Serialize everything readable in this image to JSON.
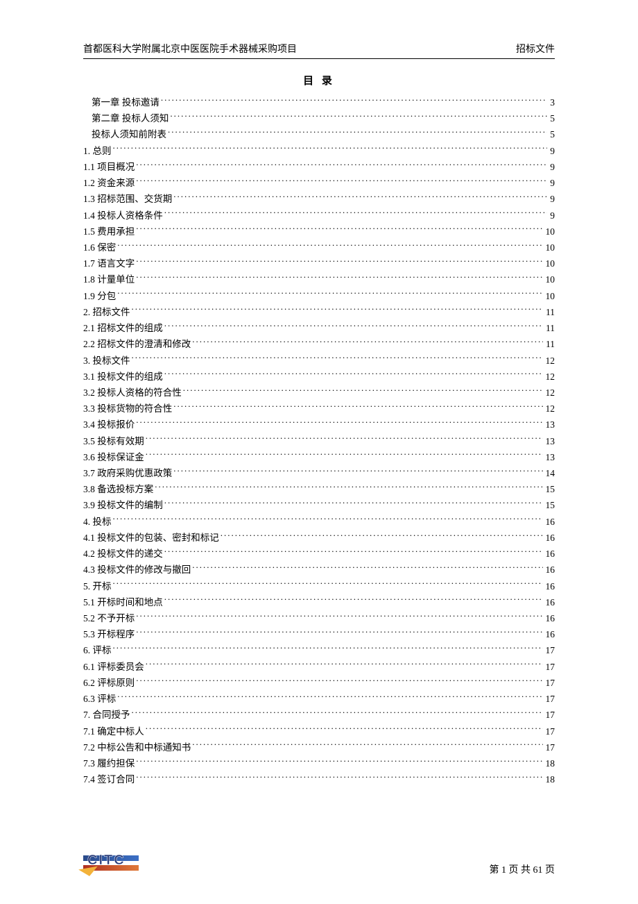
{
  "header": {
    "left": "首都医科大学附属北京中医医院手术器械采购项目",
    "right": "招标文件"
  },
  "toc_title": "目 录",
  "toc": [
    {
      "label": "第一章 投标邀请",
      "page": "3",
      "indent": true
    },
    {
      "label": "第二章 投标人须知",
      "page": "5",
      "indent": true
    },
    {
      "label": "投标人须知前附表",
      "page": "5",
      "indent": true
    },
    {
      "label": "1. 总则",
      "page": "9",
      "indent": false
    },
    {
      "label": "1.1 项目概况",
      "page": "9",
      "indent": false
    },
    {
      "label": "1.2 资金来源",
      "page": "9",
      "indent": false
    },
    {
      "label": "1.3 招标范围、交货期",
      "page": "9",
      "indent": false
    },
    {
      "label": "1.4 投标人资格条件",
      "page": "9",
      "indent": false
    },
    {
      "label": "1.5 费用承担",
      "page": "10",
      "indent": false
    },
    {
      "label": "1.6 保密",
      "page": "10",
      "indent": false
    },
    {
      "label": "1.7 语言文字",
      "page": "10",
      "indent": false
    },
    {
      "label": "1.8 计量单位",
      "page": "10",
      "indent": false
    },
    {
      "label": "1.9 分包",
      "page": "10",
      "indent": false
    },
    {
      "label": "2. 招标文件",
      "page": "11",
      "indent": false
    },
    {
      "label": "2.1 招标文件的组成",
      "page": "11",
      "indent": false
    },
    {
      "label": "2.2 招标文件的澄清和修改",
      "page": "11",
      "indent": false
    },
    {
      "label": "3. 投标文件",
      "page": "12",
      "indent": false
    },
    {
      "label": "3.1 投标文件的组成",
      "page": "12",
      "indent": false
    },
    {
      "label": "3.2 投标人资格的符合性",
      "page": "12",
      "indent": false
    },
    {
      "label": "3.3 投标货物的符合性",
      "page": "12",
      "indent": false
    },
    {
      "label": "3.4 投标报价",
      "page": "13",
      "indent": false
    },
    {
      "label": "3.5 投标有效期",
      "page": "13",
      "indent": false
    },
    {
      "label": "3.6 投标保证金",
      "page": "13",
      "indent": false
    },
    {
      "label": "3.7 政府采购优惠政策",
      "page": "14",
      "indent": false
    },
    {
      "label": "3.8 备选投标方案",
      "page": "15",
      "indent": false
    },
    {
      "label": "3.9 投标文件的编制",
      "page": "15",
      "indent": false
    },
    {
      "label": "4. 投标",
      "page": "16",
      "indent": false
    },
    {
      "label": "4.1 投标文件的包装、密封和标记",
      "page": "16",
      "indent": false
    },
    {
      "label": "4.2 投标文件的递交",
      "page": "16",
      "indent": false
    },
    {
      "label": "4.3 投标文件的修改与撤回",
      "page": "16",
      "indent": false
    },
    {
      "label": "5. 开标",
      "page": "16",
      "indent": false
    },
    {
      "label": "5.1 开标时间和地点",
      "page": "16",
      "indent": false
    },
    {
      "label": "5.2 不予开标",
      "page": "16",
      "indent": false
    },
    {
      "label": "5.3 开标程序",
      "page": "16",
      "indent": false
    },
    {
      "label": "6. 评标",
      "page": "17",
      "indent": false
    },
    {
      "label": "6.1 评标委员会",
      "page": "17",
      "indent": false
    },
    {
      "label": "6.2 评标原则",
      "page": "17",
      "indent": false
    },
    {
      "label": "6.3 评标",
      "page": "17",
      "indent": false
    },
    {
      "label": "7. 合同授予",
      "page": "17",
      "indent": false
    },
    {
      "label": "7.1 确定中标人",
      "page": "17",
      "indent": false
    },
    {
      "label": "7.2 中标公告和中标通知书",
      "page": "17",
      "indent": false
    },
    {
      "label": "7.3 履约担保",
      "page": "18",
      "indent": false
    },
    {
      "label": "7.4 签订合同",
      "page": "18",
      "indent": false
    }
  ],
  "footer": {
    "logo_text": "CITC",
    "pager": "第 1 页 共 61 页"
  }
}
